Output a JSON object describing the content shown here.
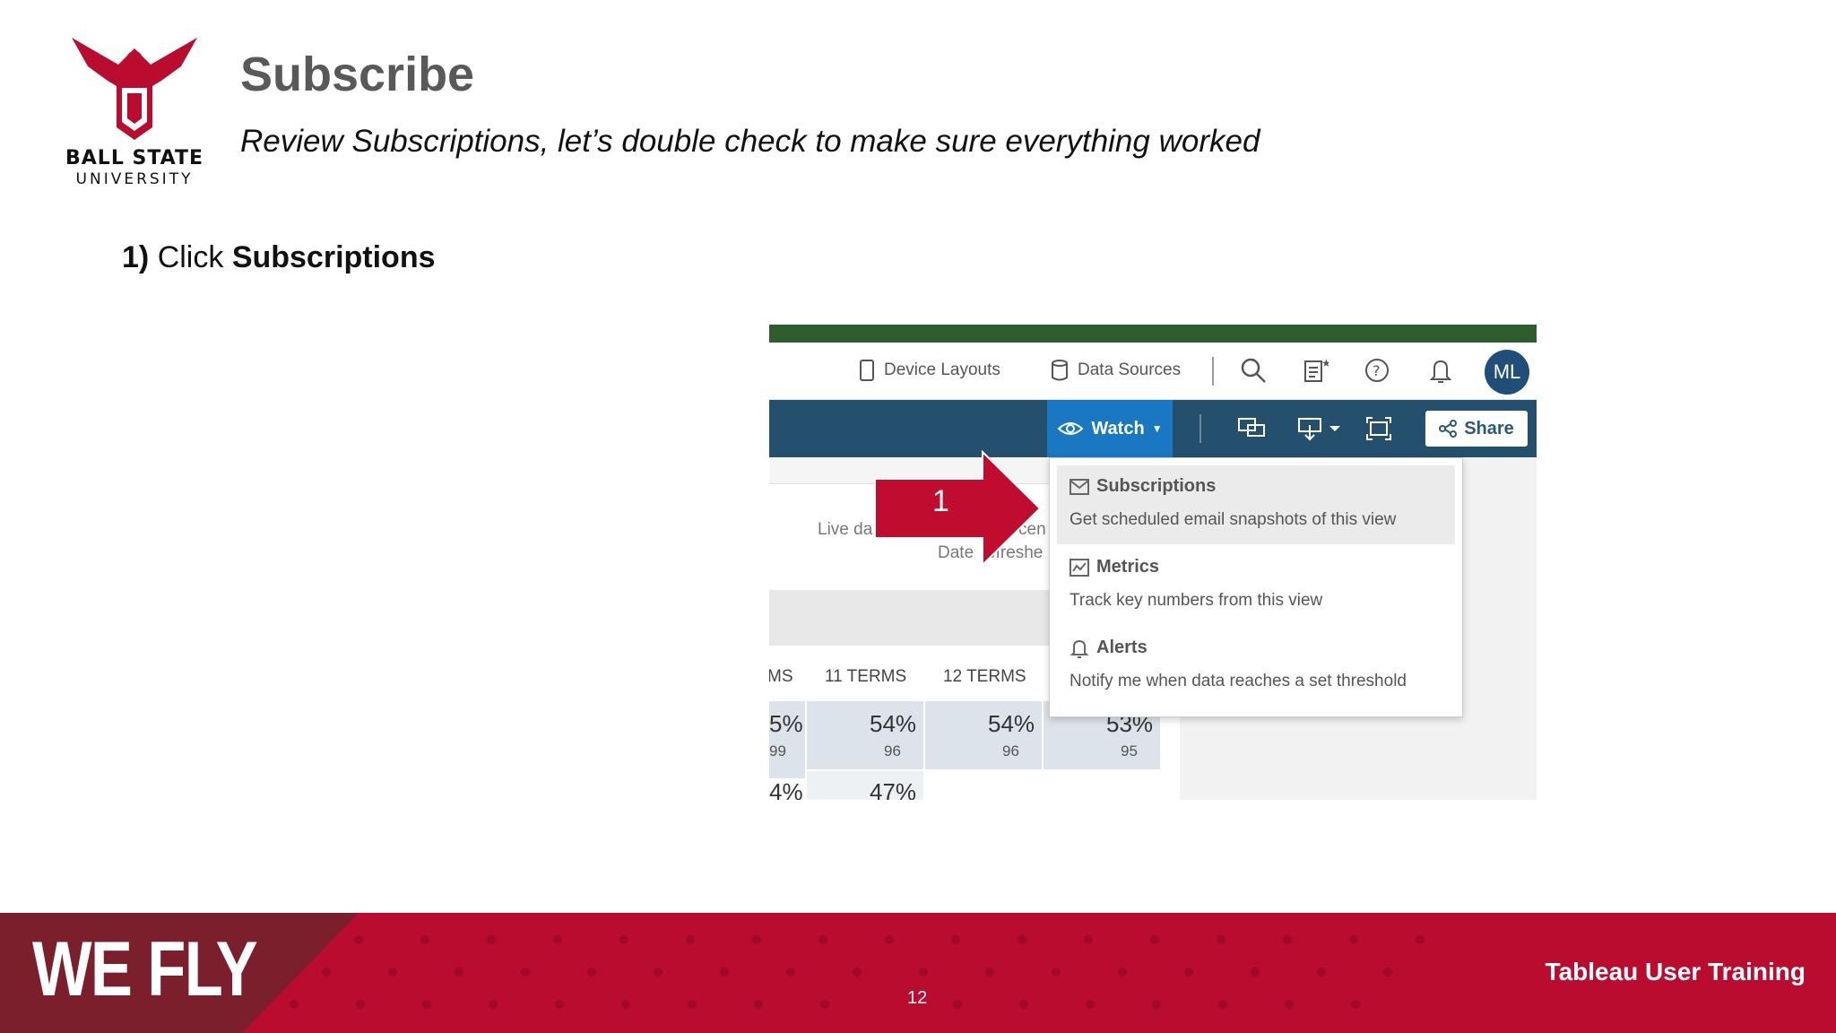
{
  "slide": {
    "title": "Subscribe",
    "subtitle": "Review Subscriptions, let’s double check to make sure everything worked",
    "step_number": "1)",
    "step_text": "Click",
    "step_target": "Subscriptions",
    "logo_line1": "BALL STATE",
    "logo_line2": "UNIVERSITY"
  },
  "toolbar": {
    "device_layouts": "Device Layouts",
    "data_sources": "Data Sources",
    "avatar_initials": "ML",
    "watch_label": "Watch",
    "share_label": "Share"
  },
  "dropdown": {
    "items": [
      {
        "title": "Subscriptions",
        "description": "Get scheduled email snapshots of this view",
        "icon": "envelope-icon"
      },
      {
        "title": "Metrics",
        "description": "Track key numbers from this view",
        "icon": "metrics-icon"
      },
      {
        "title": "Alerts",
        "description": "Notify me when data reaches a set threshold",
        "icon": "bell-icon"
      }
    ]
  },
  "background": {
    "live_line1": "Live da",
    "live_line1_right": "cen",
    "live_line2": "Date",
    "live_line2_right": "efreshe",
    "columns": [
      "MS",
      "11 TERMS",
      "12 TERMS"
    ],
    "row1": [
      {
        "pct": "5%",
        "count": "99"
      },
      {
        "pct": "54%",
        "count": "96"
      },
      {
        "pct": "54%",
        "count": "96"
      },
      {
        "pct": "53%",
        "count": "95"
      }
    ],
    "row2": [
      {
        "pct": "4%"
      },
      {
        "pct": "47%"
      }
    ]
  },
  "annotation": {
    "arrow_number": "1"
  },
  "footer": {
    "brand": "WE FLY",
    "page_number": "12",
    "course": "Tableau User Training"
  },
  "colors": {
    "brand_red": "#ba0c2f",
    "tableau_blue": "#24506e",
    "watch_blue": "#1a78c2",
    "green_bar": "#2e5e2e"
  }
}
